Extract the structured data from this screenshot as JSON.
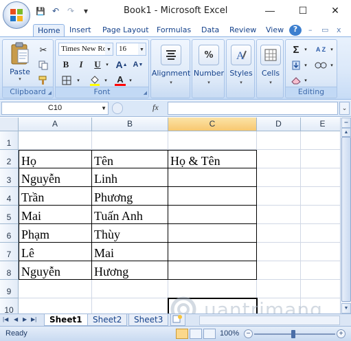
{
  "window": {
    "title": "Book1 - Microsoft Excel",
    "controls": {
      "minimize": "—",
      "maximize": "☐",
      "close": "✕"
    }
  },
  "qat": {
    "save": "💾",
    "undo": "↶",
    "redo": "↷",
    "customize": "▾"
  },
  "tabs": [
    "Home",
    "Insert",
    "Page Layout",
    "Formulas",
    "Data",
    "Review",
    "View"
  ],
  "active_tab": "Home",
  "help_icons": {
    "help": "?",
    "min": "–",
    "restore": "▭",
    "close": "x"
  },
  "ribbon": {
    "clipboard": {
      "label": "Clipboard",
      "paste": "Paste"
    },
    "font": {
      "label": "Font",
      "font_name": "Times New Ro",
      "font_size": "16",
      "bold": "B",
      "italic": "I",
      "underline": "U",
      "grow": "A",
      "shrink": "A",
      "font_color_letter": "A"
    },
    "alignment": {
      "label": "Alignment"
    },
    "number": {
      "label": "Number",
      "icon_text": "%"
    },
    "styles": {
      "label": "Styles"
    },
    "cells": {
      "label": "Cells"
    },
    "editing": {
      "label": "Editing",
      "sum": "Σ",
      "sort": "A Z"
    }
  },
  "formula_bar": {
    "name_box": "C10",
    "fx": "fx",
    "formula": ""
  },
  "colors": {
    "header_selected": "#f8c870",
    "ribbon_bg": "#dbe8f9",
    "grid_line": "#d0d7e5"
  },
  "columns": [
    "A",
    "B",
    "C",
    "D",
    "E"
  ],
  "selected_column": "C",
  "rows": [
    "1",
    "2",
    "3",
    "4",
    "5",
    "6",
    "7",
    "8",
    "9",
    "10"
  ],
  "cells": {
    "r2": [
      "Họ",
      "Tên",
      "Họ & Tên"
    ],
    "r3": [
      "Nguyễn",
      "Linh",
      ""
    ],
    "r4": [
      "Trần",
      "Phương",
      ""
    ],
    "r5": [
      "Mai",
      "Tuấn Anh",
      ""
    ],
    "r6": [
      "Phạm",
      "Thùy",
      ""
    ],
    "r7": [
      "Lê",
      "Mai",
      ""
    ],
    "r8": [
      "Nguyễn",
      "Hương",
      ""
    ]
  },
  "selected_cell": "C10",
  "sheets": [
    "Sheet1",
    "Sheet2",
    "Sheet3"
  ],
  "active_sheet": "Sheet1",
  "status": {
    "ready": "Ready",
    "zoom": "100%",
    "zoom_level": 1.0
  },
  "watermark": "uantrimang"
}
